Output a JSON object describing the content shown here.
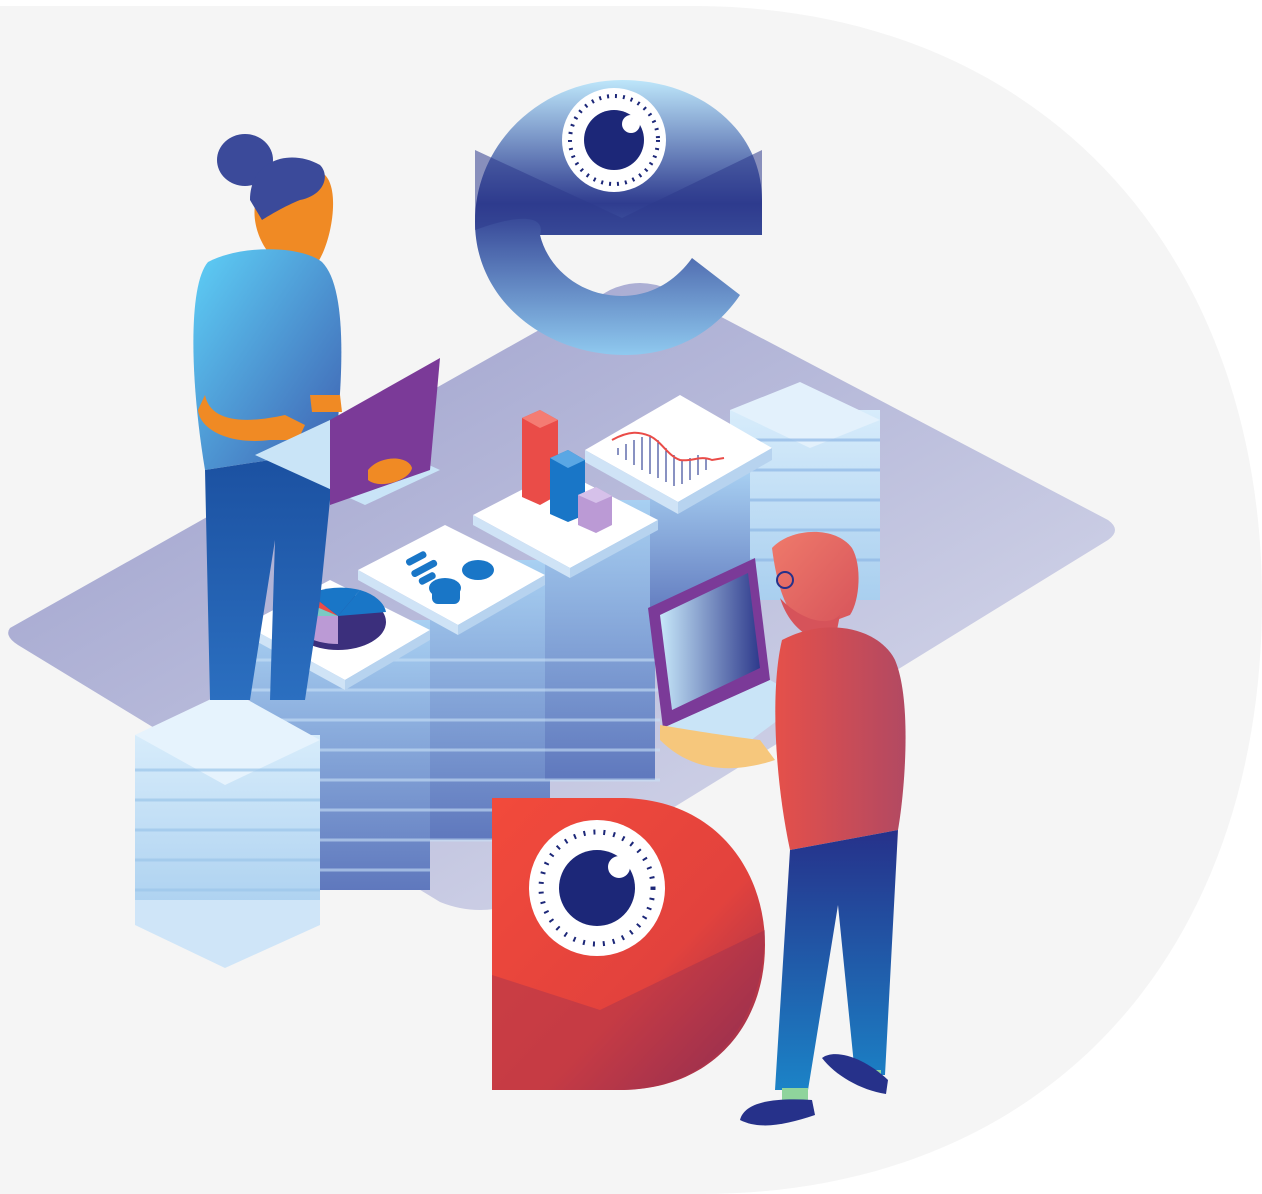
{
  "illustration": {
    "icons": [
      "lowercase-e-letter-logo",
      "capital-d-letter-logo",
      "eye-icon",
      "pie-chart-icon",
      "bar-chart-icon",
      "line-chart-icon",
      "profile-card-icon",
      "laptop-icon"
    ],
    "people": [
      "woman-with-laptop",
      "man-with-laptop"
    ]
  },
  "colors": {
    "background_blob": "#f5f5f5",
    "platform": "#7d82bf",
    "server_light": "#cfe5f8",
    "server_dark": "#6f86c4",
    "letter_e_top": "#b3def6",
    "letter_e_bottom": "#2e3a8c",
    "letter_d": "#ef4438",
    "letter_d_dark": "#8b2c4f",
    "eye_navy": "#1c2778",
    "woman_hair": "#3b4a9a",
    "woman_skin": "#f08a24",
    "woman_shirt": "#5cc5f2",
    "woman_pants": "#1a5aa8",
    "laptop_purple": "#7b3a98",
    "man_hair": "#e86a66",
    "man_shirt": "#d8544f",
    "man_pants": "#223a92",
    "man_skin": "#f6c77c",
    "chart_red": "#ea4c48",
    "chart_blue": "#1976c7",
    "chart_lilac": "#bb9ad5"
  }
}
